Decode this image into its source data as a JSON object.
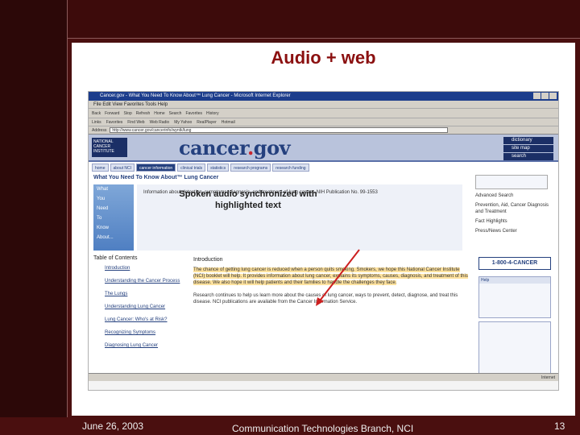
{
  "slide": {
    "title": "Audio + web"
  },
  "browser": {
    "window_title": "Cancer.gov - What You Need To Know About™ Lung Cancer - Microsoft Internet Explorer",
    "menu": "File   Edit   View   Favorites   Tools   Help",
    "toolbar": [
      "Back",
      "Forward",
      "Stop",
      "Refresh",
      "Home",
      "Search",
      "Favorites",
      "History"
    ],
    "links": [
      "Links",
      "Favorites",
      "Find Web",
      "Web Radio",
      "My Yahoo",
      "RealPlayer",
      "Hotmail"
    ],
    "address_label": "Address",
    "address_value": "http://www.cancer.gov/cancerinfo/wyntk/lung",
    "status_text": "Internet"
  },
  "site": {
    "nci_logo": "NATIONAL CANCER INSTITUTE",
    "logo_text": "cancer",
    "logo_dot": ".",
    "logo_tld": "gov",
    "side_nav": [
      "dictionary",
      "site map",
      "search"
    ],
    "tabs": [
      "home",
      "about NCI",
      "cancer information",
      "clinical trials",
      "statistics",
      "research programs",
      "research funding"
    ],
    "page_heading": "What You Need To Know About™ Lung Cancer",
    "figure_labels": [
      "What",
      "You",
      "Need",
      "To",
      "Know",
      "About..."
    ],
    "intro_box_text": "Information about detection, symptoms, diagnosis, and treatment of lung cancer. NIH Publication No. 99-1553",
    "right_col": [
      "Advanced Search",
      "Prevention, Aid, Cancer Diagnosis and Treatment",
      "Fact Highlights",
      "Press/News Center"
    ],
    "phone": "1-800-4-CANCER",
    "help_title": "Help",
    "toc_title": "Table of Contents",
    "toc_items": [
      "Introduction",
      "Understanding the Cancer Process",
      "The Lungs",
      "Understanding Lung Cancer",
      "Lung Cancer: Who's at Risk?",
      "Recognizing Symptoms",
      "Diagnosing Lung Cancer"
    ],
    "intro_title": "Introduction",
    "intro_text": "The chance of getting lung cancer is reduced when a person quits smoking. Smokers, we hope this National Cancer Institute (NCI) booklet will help. It provides information about lung cancer, explains its symptoms, causes, diagnosis, and treatment of this disease. We also hope it will help patients and their families to handle the challenges they face.",
    "intro_text_2": "Research continues to help us learn more about the causes of lung cancer, ways to prevent, detect, diagnose, and treat this disease. NCI publications are available from the Cancer Information Service."
  },
  "callout": {
    "line1": "Spoken audio synchronized with",
    "line2": "highlighted text"
  },
  "footer": {
    "date": "June 26, 2003",
    "org": "Communication Technologies Branch, NCI",
    "page": "13"
  },
  "colors": {
    "slide_background": "#4a0f0f",
    "title": "#8b1010",
    "highlight": "#ffe29e",
    "arrow": "#cc1f1f"
  }
}
